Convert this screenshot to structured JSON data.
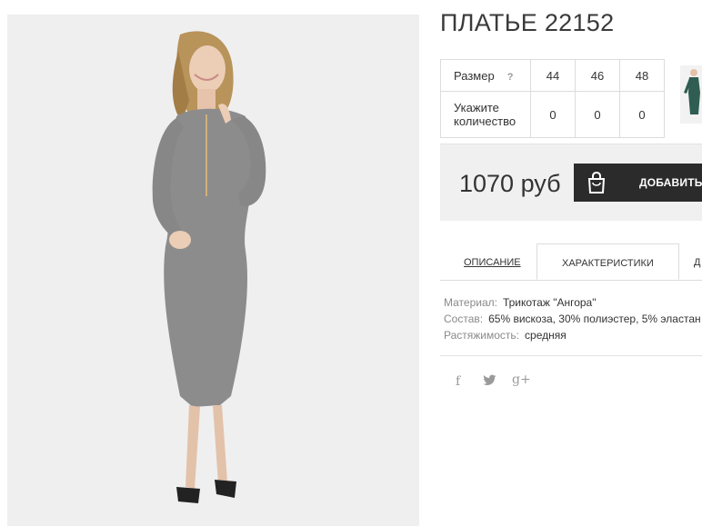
{
  "product": {
    "title": "ПЛАТЬЕ 22152",
    "image_alt": "Женщина в сером трикотажном платье"
  },
  "sizes": {
    "size_label": "Размер",
    "help_mark": "?",
    "quantity_label": "Укажите количество",
    "columns": [
      "44",
      "46",
      "48"
    ],
    "quantities": [
      "0",
      "0",
      "0"
    ]
  },
  "purchase": {
    "price": "1070 руб",
    "add_to_cart_label": "ДОБАВИТЬ В"
  },
  "tabs": [
    {
      "label": "ОПИСАНИЕ",
      "active": false
    },
    {
      "label": "ХАРАКТЕРИСТИКИ",
      "active": true
    },
    {
      "label": "Д",
      "active": false
    }
  ],
  "specs": [
    {
      "key": "Материал:",
      "value": "Трикотаж \"Ангора\""
    },
    {
      "key": "Состав:",
      "value": "65% вискоза, 30% полиэстер, 5% эластан"
    },
    {
      "key": "Растяжимость:",
      "value": "средняя"
    }
  ],
  "social": {
    "facebook": "f",
    "twitter": "🐦",
    "googleplus": "g+"
  },
  "colors": {
    "button_bg": "#2b2b2b",
    "buybar_bg": "#f0f0f0",
    "dress": "#8c8c8c"
  }
}
